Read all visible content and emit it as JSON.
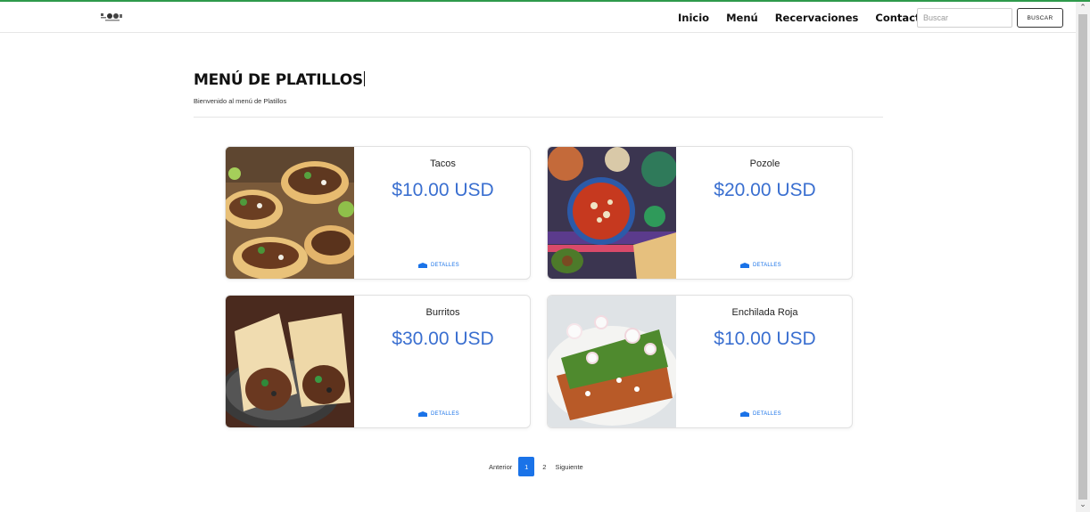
{
  "nav": {
    "links": [
      "Inicio",
      "Menú",
      "Recervaciones",
      "Contactos"
    ],
    "search_placeholder": "Buscar",
    "search_button": "BUSCAR"
  },
  "page": {
    "title": "MENÚ DE PLATILLOS",
    "subtitle": "Bienvenido al menú de Platillos"
  },
  "dishes": [
    {
      "name": "Tacos",
      "price": "$10.00 USD",
      "link": "DETALLES"
    },
    {
      "name": "Pozole",
      "price": "$20.00 USD",
      "link": "DETALLES"
    },
    {
      "name": "Burritos",
      "price": "$30.00 USD",
      "link": "DETALLES"
    },
    {
      "name": "Enchilada Roja",
      "price": "$10.00 USD",
      "link": "DETALLES"
    }
  ],
  "pagination": {
    "prev": "Anterior",
    "current": "1",
    "next_page": "2",
    "next": "Siguiente"
  },
  "colors": {
    "price_blue": "#3a6fd0",
    "link_blue": "#1a73e8",
    "top_accent": "#2e9a4b"
  }
}
